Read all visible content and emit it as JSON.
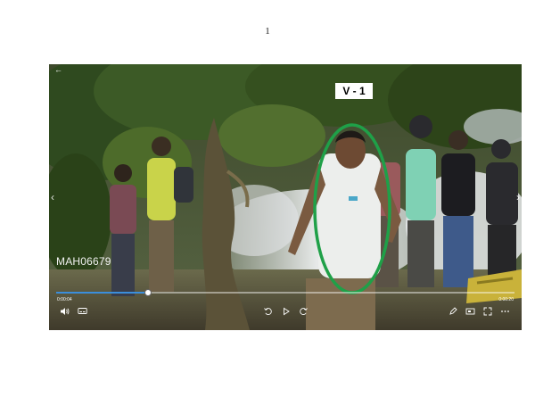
{
  "page": {
    "number": "1"
  },
  "player": {
    "back_icon": "back-arrow-icon",
    "annotation_label": "V - 1",
    "annotation_color": "#1fa048",
    "watermark": "MAH06679",
    "time_current": "0:00:04",
    "time_total": "0:00:20",
    "progress": 0.2,
    "accent": "#3b8edb",
    "controls": [
      "volume-icon",
      "subtitles-icon",
      "skip-back-icon",
      "play-icon",
      "skip-forward-icon",
      "edit-icon",
      "aspect-ratio-icon",
      "fullscreen-icon",
      "more-icon"
    ]
  }
}
